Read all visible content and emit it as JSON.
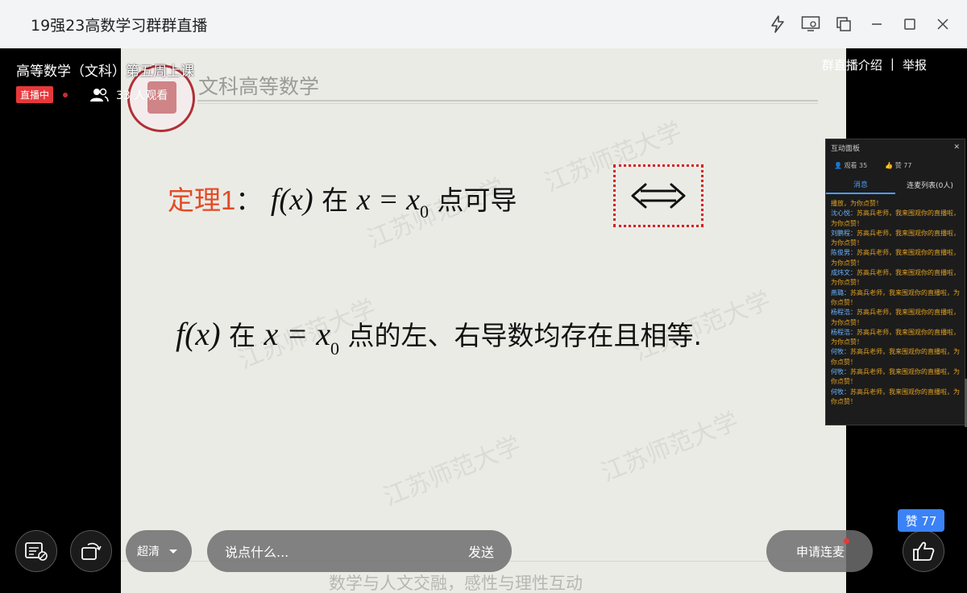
{
  "window": {
    "title": "19强23高数学习群群直播"
  },
  "live": {
    "course_title": "高等数学（文科）第五周上课",
    "status_badge": "直播中",
    "viewers_text": "33 人观看",
    "intro_link": "群直播介绍",
    "separator": "|",
    "report_link": "举报"
  },
  "slide": {
    "header_title": "文科高等数学",
    "watermark_text": "江苏师范大学",
    "theorem_label": "定理1",
    "theorem_colon": "：",
    "theorem_fx": "f(x)",
    "theorem_at": "在",
    "theorem_x_eq": "x = x",
    "theorem_sub": "0",
    "theorem_tail": "点可导",
    "equiv_symbol": "⟺",
    "stmt_fx": "f(x)",
    "stmt_at": "在",
    "stmt_x_eq": "x = x",
    "stmt_sub": "0",
    "stmt_tail": "点的左、右导数均存在且相等.",
    "slogan": "数学与人文交融，感性与理性互动"
  },
  "panel": {
    "title": "互动面板",
    "viewers": "观看 35",
    "likes": "赞 77",
    "tab_messages": "消息",
    "tab_mic_list": "连麦列表(0人)",
    "messages": [
      {
        "name": "",
        "text": "播放，为你点赞！"
      },
      {
        "name": "沈心悦：",
        "text": "苏高兵老师，我来围观你的直播啦，为你点赞！"
      },
      {
        "name": "刘鹏程：",
        "text": "苏高兵老师，我来围观你的直播啦，为你点赞！"
      },
      {
        "name": "陈俊男：",
        "text": "苏高兵老师，我来围观你的直播啦，为你点赞！"
      },
      {
        "name": "成炜文：",
        "text": "苏高兵老师，我来围观你的直播啦，为你点赞！"
      },
      {
        "name": "燕璐：",
        "text": "苏高兵老师，我来围观你的直播啦，为你点赞！"
      },
      {
        "name": "杨程浩：",
        "text": "苏高兵老师，我来围观你的直播啦，为你点赞！"
      },
      {
        "name": "杨程浩：",
        "text": "苏高兵老师，我来围观你的直播啦，为你点赞！"
      },
      {
        "name": "何牧：",
        "text": "苏高兵老师，我来围观你的直播啦，为你点赞！"
      },
      {
        "name": "何牧：",
        "text": "苏高兵老师，我来围观你的直播啦，为你点赞！"
      },
      {
        "name": "何牧：",
        "text": "苏高兵老师，我来围观你的直播啦，为你点赞！"
      }
    ]
  },
  "controls": {
    "quality_label": "超清",
    "comment_placeholder": "说点什么...",
    "send_label": "发送",
    "apply_mic_label": "申请连麦",
    "likes_badge": "赞 77"
  }
}
